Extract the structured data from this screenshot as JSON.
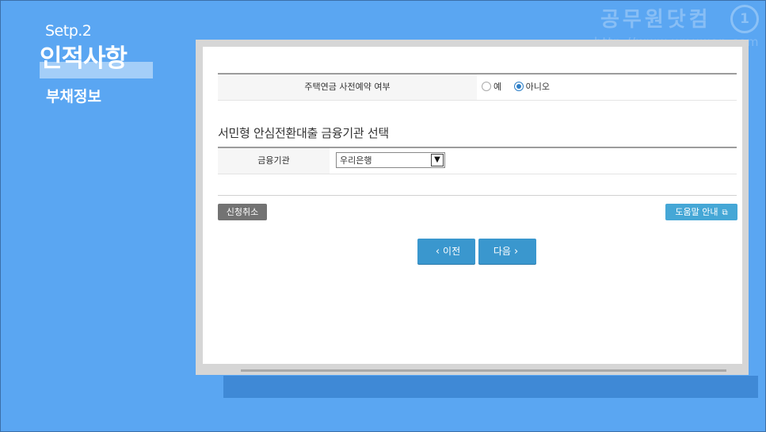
{
  "step": {
    "label": "Setp.2",
    "title": "인적사항",
    "subtitle": "부채정보"
  },
  "watermark": {
    "text": "공무원닷컴",
    "url": "http://www.umuwon.com",
    "logo": "1"
  },
  "form": {
    "reservation": {
      "label": "주택연금 사전예약 여부",
      "options": [
        {
          "label": "예",
          "checked": false
        },
        {
          "label": "아니오",
          "checked": true
        }
      ]
    },
    "section_title": "서민형 안심전환대출 금융기관 선택",
    "institution": {
      "label": "금융기관",
      "selected": "우리은행",
      "arrow_icon": "chevron-down-icon"
    }
  },
  "buttons": {
    "cancel": "신청취소",
    "help": "도움말 안내",
    "prev": "이전",
    "next": "다음"
  },
  "colors": {
    "background": "#5aa6f2",
    "nav_button": "#3a97ce",
    "help_button": "#45a7d6",
    "cancel_button": "#737373"
  }
}
